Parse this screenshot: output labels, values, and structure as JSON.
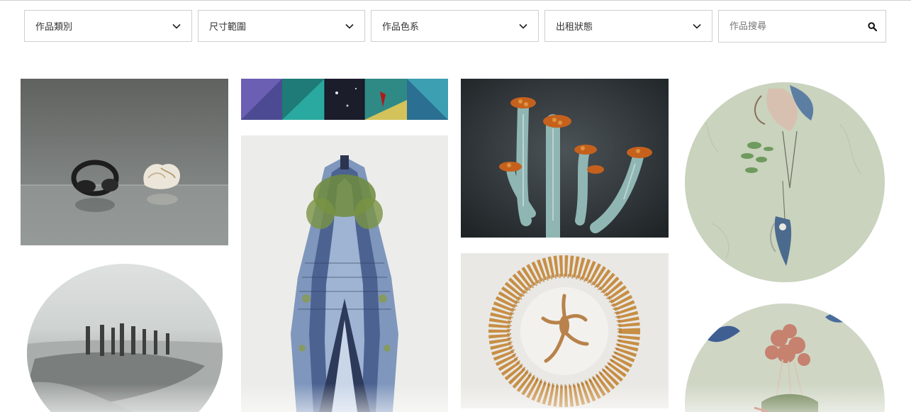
{
  "filters": [
    {
      "label": "作品類別",
      "icon": "chevron-down-icon"
    },
    {
      "label": "尺寸範圍",
      "icon": "chevron-down-icon"
    },
    {
      "label": "作品色系",
      "icon": "chevron-down-icon"
    },
    {
      "label": "出租狀態",
      "icon": "chevron-down-icon"
    }
  ],
  "search": {
    "placeholder": "作品搜尋",
    "icon": "search-icon"
  },
  "colors": {
    "border": "#cfcfcf",
    "text": "#333333",
    "background": "#ffffff"
  }
}
